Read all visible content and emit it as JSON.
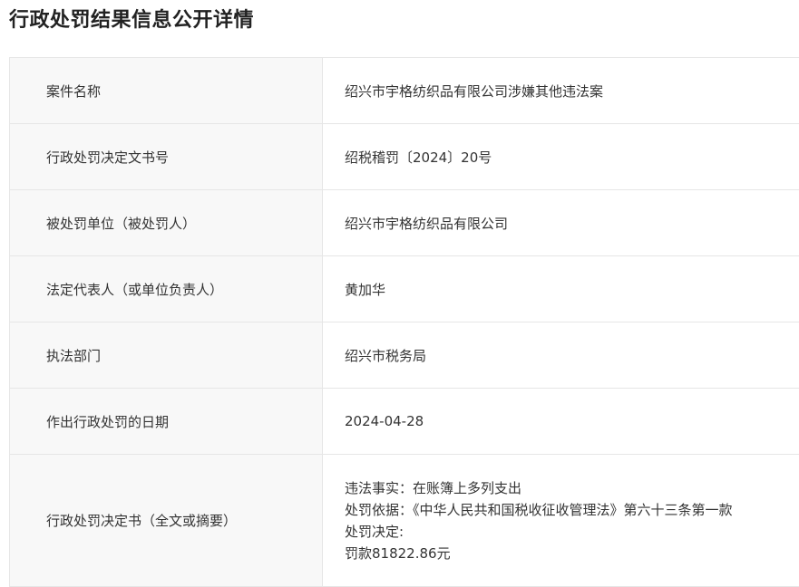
{
  "page": {
    "title": "行政处罚结果信息公开详情"
  },
  "rows": [
    {
      "label": "案件名称",
      "value": "绍兴市宇格纺织品有限公司涉嫌其他违法案"
    },
    {
      "label": "行政处罚决定文书号",
      "value": "绍税稽罚〔2024〕20号"
    },
    {
      "label": "被处罚单位（被处罚人）",
      "value": "绍兴市宇格纺织品有限公司"
    },
    {
      "label": "法定代表人（或单位负责人）",
      "value": "黄加华"
    },
    {
      "label": "执法部门",
      "value": "绍兴市税务局"
    },
    {
      "label": "作出行政处罚的日期",
      "value": "2024-04-28"
    }
  ],
  "decision": {
    "label": "行政处罚决定书（全文或摘要）",
    "lines": [
      "违法事实：在账簿上多列支出",
      "处罚依据：《中华人民共和国税收征收管理法》第六十三条第一款",
      "处罚决定:",
      "罚款81822.86元"
    ]
  }
}
